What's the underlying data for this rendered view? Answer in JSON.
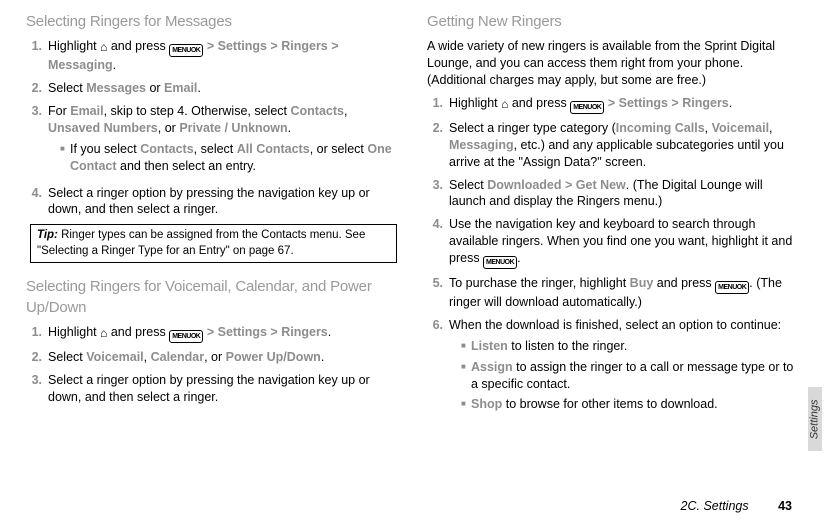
{
  "icons": {
    "menu_ok_top": "MENU",
    "menu_ok_bot": "OK",
    "gt": ">"
  },
  "left": {
    "h_msg": "Selecting Ringers for Messages",
    "msg_steps": [
      {
        "n": "1.",
        "pre": "Highlight ",
        "mid": " and press ",
        "post1": "Settings",
        "post2": "Ringers",
        "post3": "Messaging",
        "tail": "."
      },
      {
        "n": "2.",
        "pre": "Select ",
        "a": "Messages",
        "or": " or ",
        "b": "Email",
        "tail": "."
      },
      {
        "n": "3.",
        "pre": "For ",
        "a": "Email",
        "mid": ", skip to step 4. Otherwise, select ",
        "b": "Contacts",
        "c": "Unsaved Numbers",
        "d": "Private / Unknown",
        "tail": "."
      },
      {
        "sub": true,
        "pre": "If you select ",
        "a": "Contacts",
        "mid": ", select ",
        "b": "All Contacts",
        "mid2": ", or select ",
        "c": "One Contact",
        "tail": " and then select an entry."
      },
      {
        "n": "4.",
        "text": "Select a ringer option by pressing the navigation key up or down, and then select a ringer."
      }
    ],
    "tip_label": "Tip:",
    "tip_text": " Ringer types can be assigned from the Contacts menu. See \"Selecting a Ringer Type for an Entry\" on page 67.",
    "h_vm": "Selecting Ringers for Voicemail, Calendar, and Power Up/Down",
    "vm_steps": [
      {
        "n": "1.",
        "pre": "Highlight ",
        "mid": " and press ",
        "a": "Settings",
        "b": "Ringers",
        "tail": "."
      },
      {
        "n": "2.",
        "pre": "Select ",
        "a": "Voicemail",
        "b": "Calendar",
        "c": "Power Up/Down",
        "tail": "."
      },
      {
        "n": "3.",
        "text": "Select a ringer option by pressing the navigation key up or down, and then select a ringer."
      }
    ]
  },
  "right": {
    "h_new": "Getting New Ringers",
    "intro": "A wide variety of new ringers is available from the Sprint Digital Lounge, and you can access them right from your phone. (Additional charges may apply, but some are free.)",
    "steps": [
      {
        "n": "1.",
        "pre": "Highlight ",
        "mid": " and press ",
        "a": "Settings",
        "b": "Ringers",
        "tail": "."
      },
      {
        "n": "2.",
        "pre": "Select a ringer type category (",
        "a": "Incoming Calls",
        "b": "Voicemail",
        "c": "Messaging",
        "tail": ", etc.) and any applicable subcategories until you arrive at the \"Assign Data?\" screen."
      },
      {
        "n": "3.",
        "pre": "Select ",
        "a": "Downloaded > Get New",
        "tail": ". (The Digital Lounge will launch and display the Ringers menu.)"
      },
      {
        "n": "4.",
        "pre": "Use the navigation key and keyboard to search through available ringers. When you find one you want, highlight it and press ",
        "tail": "."
      },
      {
        "n": "5.",
        "pre": "To purchase the ringer, highlight ",
        "a": "Buy",
        "mid": " and press ",
        "tail": ". (The ringer will download automatically.)"
      },
      {
        "n": "6.",
        "pre": "When the download is finished, select an option to continue:"
      }
    ],
    "subs": [
      {
        "a": "Listen",
        "tail": " to listen to the ringer."
      },
      {
        "a": "Assign",
        "tail": " to assign the ringer to a call or message type or to a specific contact."
      },
      {
        "a": "Shop",
        "tail": " to browse for other items to download."
      }
    ]
  },
  "side_tab": "Settings",
  "footer_section": "2C. Settings",
  "footer_page": "43"
}
